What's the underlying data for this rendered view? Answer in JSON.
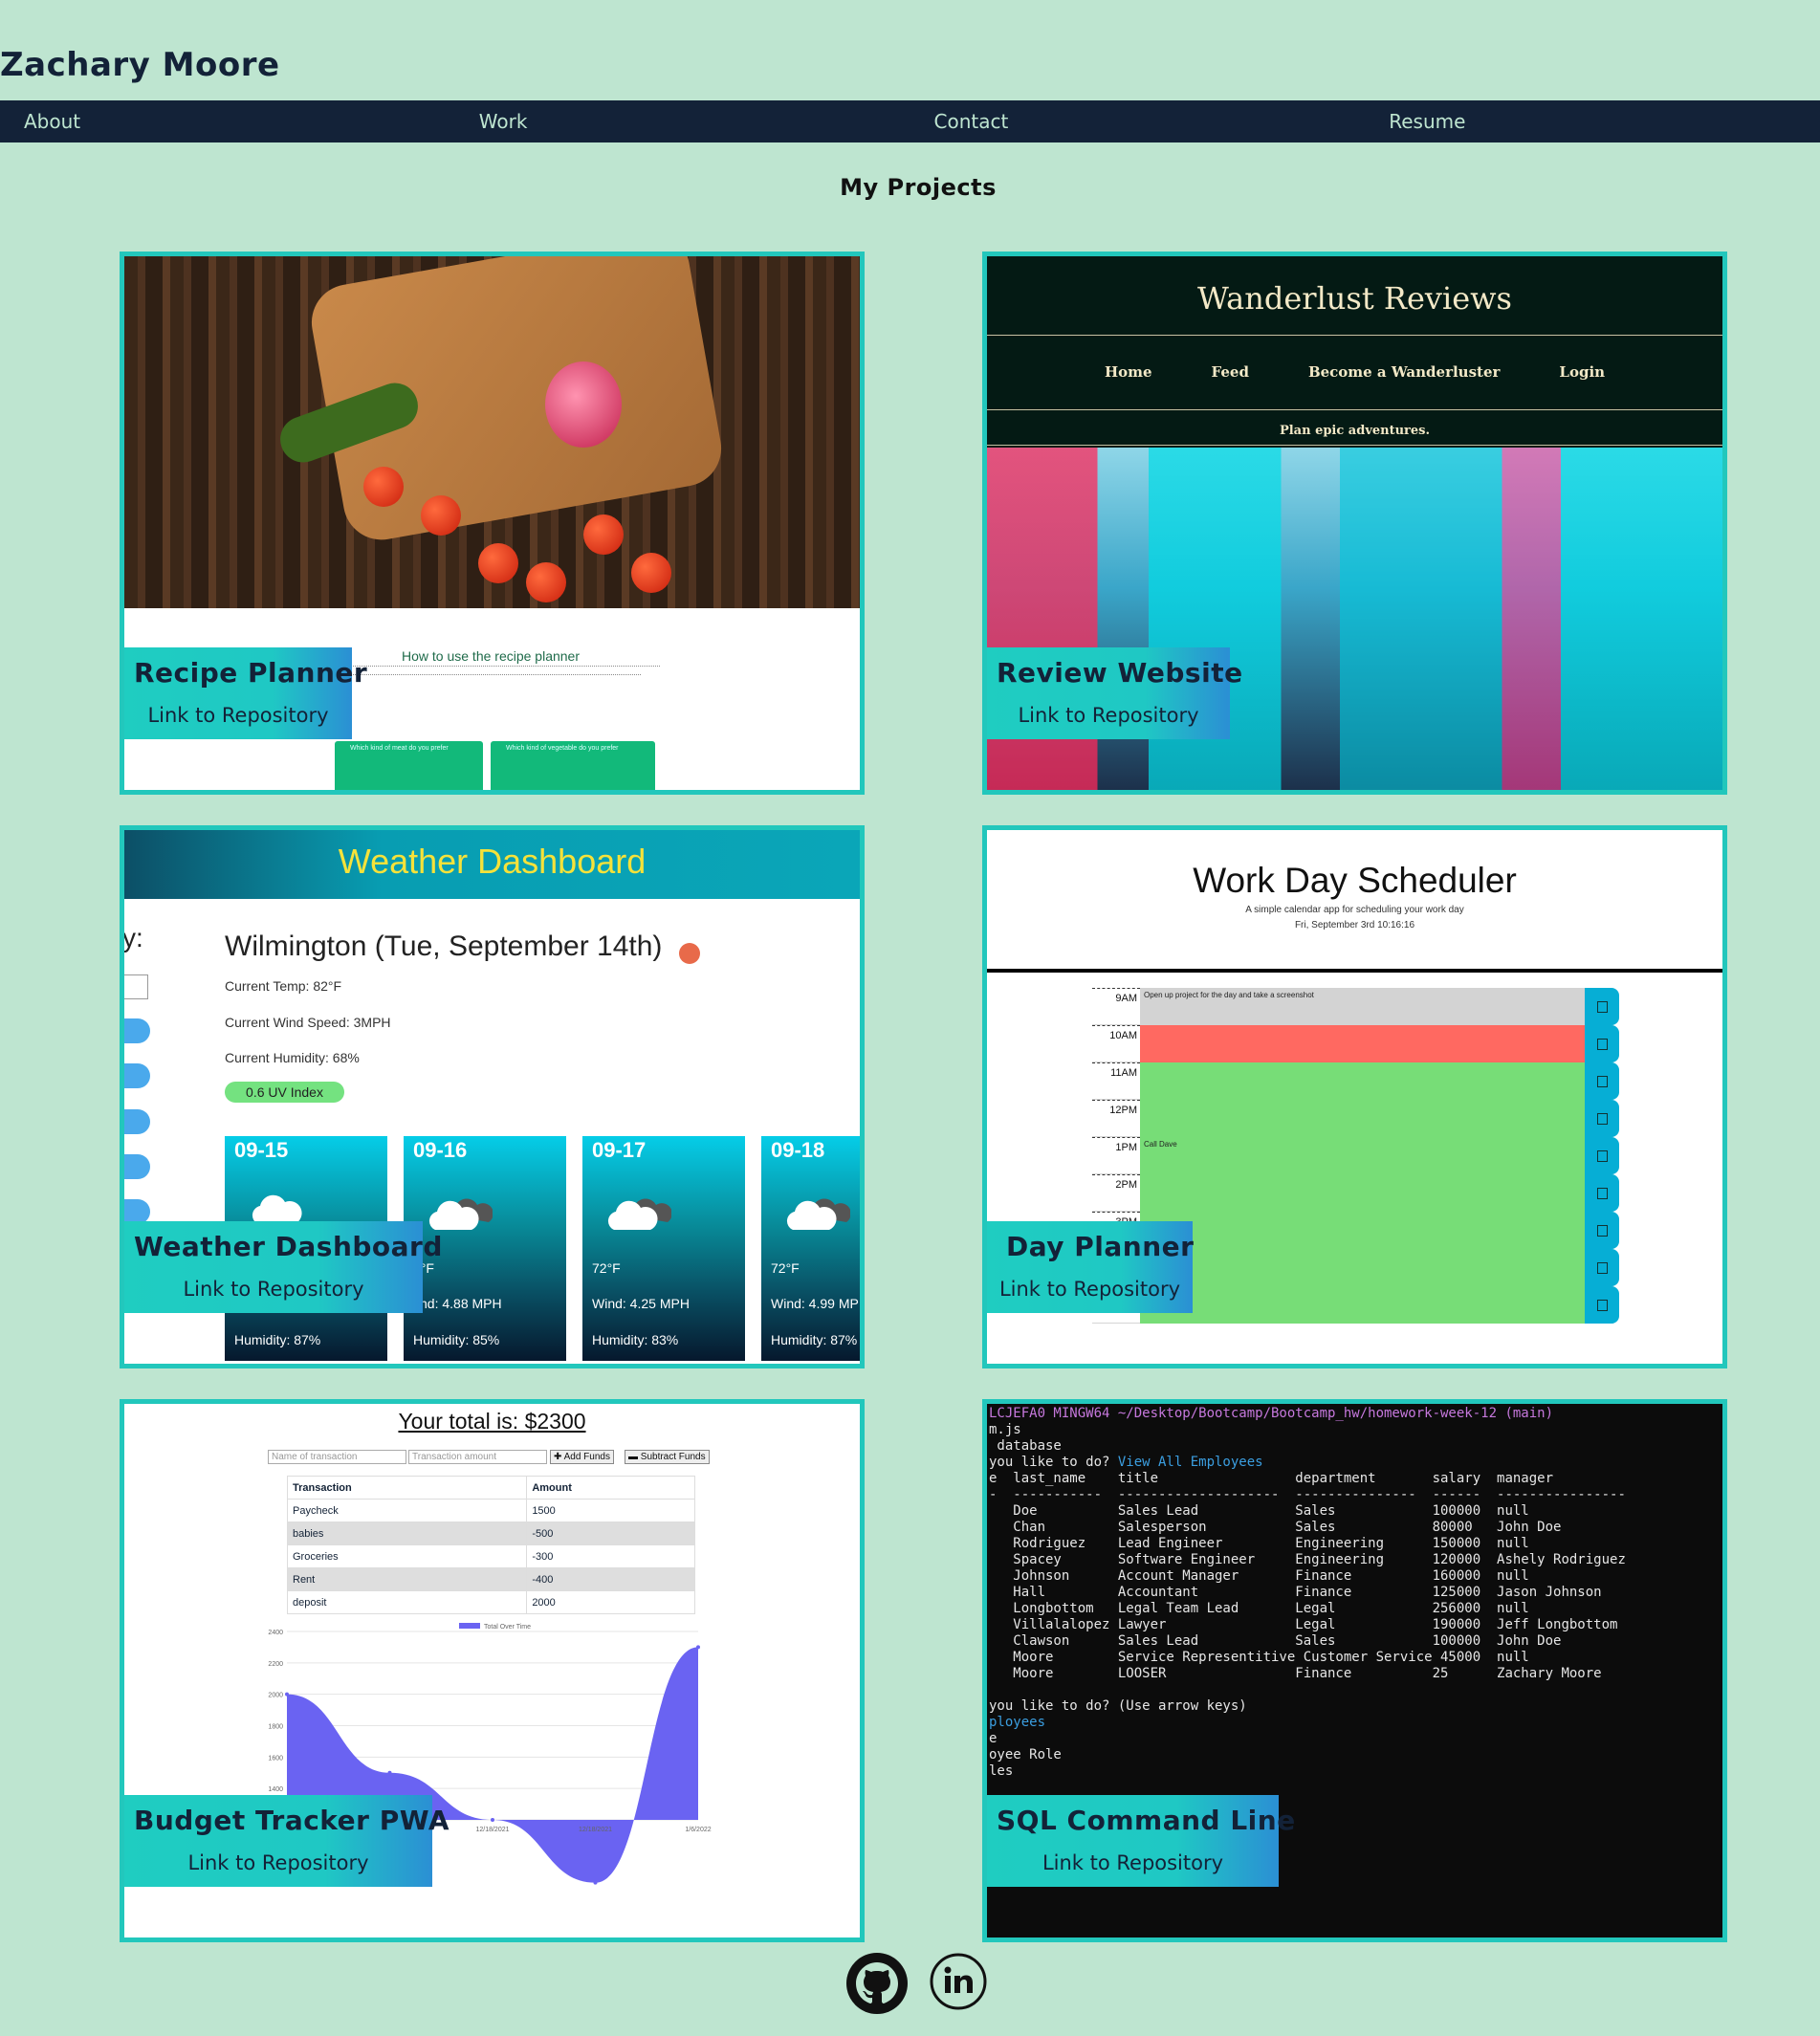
{
  "header": {
    "title": "Zachary Moore"
  },
  "nav": {
    "items": [
      "About",
      "Work",
      "Contact",
      "Resume"
    ]
  },
  "main": {
    "heading": "My Projects",
    "projects": [
      {
        "title": "Recipe Planner",
        "link": "Link to Repository"
      },
      {
        "title": "Review Website",
        "link": "Link to Repository"
      },
      {
        "title": "Weather Dashboard",
        "link": "Link to Repository"
      },
      {
        "title": "Day Planner",
        "link": "Link to Repository"
      },
      {
        "title": "Budget Tracker PWA",
        "link": "Link to Repository"
      },
      {
        "title": "SQL Command Line",
        "link": "Link to Repository"
      }
    ]
  },
  "screens": {
    "recipe": {
      "heading": "How to use the recipe planner",
      "meat_box": "Which kind of meat do you prefer",
      "veg_box": "Which kind of vegetable do you prefer"
    },
    "wanderlust": {
      "title": "Wanderlust Reviews",
      "nav": [
        "Home",
        "Feed",
        "Become a Wanderluster",
        "Login"
      ],
      "tagline": "Plan epic adventures."
    },
    "weather": {
      "header": "Weather Dashboard",
      "prefix": "y:",
      "city": "Wilmington (Tue, September 14th)",
      "temp": "Current Temp: 82°F",
      "wind": "Current Wind Speed: 3MPH",
      "humidity": "Current Humidity: 68%",
      "uv": "0.6 UV Index",
      "forecast": [
        {
          "date": "09-15",
          "temp": "",
          "wind": "",
          "humidity": "Humidity: 87%"
        },
        {
          "date": "09-16",
          "temp": "3°F",
          "wind": "/ind: 4.88 MPH",
          "humidity": "Humidity: 85%"
        },
        {
          "date": "09-17",
          "temp": "72°F",
          "wind": "Wind: 4.25 MPH",
          "humidity": "Humidity: 83%"
        },
        {
          "date": "09-18",
          "temp": "72°F",
          "wind": "Wind: 4.99 MP",
          "humidity": "Humidity: 87%"
        }
      ]
    },
    "scheduler": {
      "title": "Work Day Scheduler",
      "subtitle": "A simple calendar app for scheduling your work day",
      "date": "Fri, September 3rd 10:16:16",
      "rows": [
        {
          "hour": "9AM",
          "text": "Open up project for the day and take a screenshot",
          "state": "past"
        },
        {
          "hour": "10AM",
          "text": "",
          "state": "present"
        },
        {
          "hour": "11AM",
          "text": "",
          "state": "future"
        },
        {
          "hour": "12PM",
          "text": "",
          "state": "future"
        },
        {
          "hour": "1PM",
          "text": "Call Dave",
          "state": "future"
        },
        {
          "hour": "2PM",
          "text": "",
          "state": "future"
        },
        {
          "hour": "3PM",
          "text": "",
          "state": "future"
        },
        {
          "hour": "",
          "text": "",
          "state": "future"
        },
        {
          "hour": "",
          "text": "",
          "state": "future"
        }
      ]
    },
    "budget": {
      "total": "Your total is: $2300",
      "name_placeholder": "Name of transaction",
      "amount_placeholder": "Transaction amount",
      "add_label": "✚ Add Funds",
      "sub_label": "▬ Subtract Funds",
      "headers": [
        "Transaction",
        "Amount"
      ],
      "rows": [
        [
          "Paycheck",
          "1500"
        ],
        [
          "babies",
          "-500"
        ],
        [
          "Groceries",
          "-300"
        ],
        [
          "Rent",
          "-400"
        ],
        [
          "deposit",
          "2000"
        ]
      ],
      "legend": "Total Over Time",
      "yticks": [
        "2400",
        "2200",
        "2000",
        "1800",
        "1600",
        "1400",
        "1200"
      ],
      "xticks": [
        "12/18/2021",
        "12/18/2021",
        "1/6/2022"
      ]
    },
    "sql": {
      "prompt": "LCJEFA0 MINGW64 ~/Desktop/Bootcamp/Bootcamp_hw/homework-week-12 (main)",
      "lines": [
        "m.js",
        " database",
        "you like to do? ",
        "e  last_name    title                 department       salary  manager",
        "-  -----------  --------------------  ---------------  ------  ----------------",
        "   Doe          Sales Lead            Sales            100000  null",
        "   Chan         Salesperson           Sales            80000   John Doe",
        "   Rodriguez    Lead Engineer         Engineering      150000  null",
        "   Spacey       Software Engineer     Engineering      120000  Ashely Rodriguez",
        "   Johnson      Account Manager       Finance          160000  null",
        "   Hall         Accountant            Finance          125000  Jason Johnson",
        "   Longbottom   Legal Team Lead       Legal            256000  null",
        "   Villalalopez Lawyer                Legal            190000  Jeff Longbottom",
        "   Clawson      Sales Lead            Sales            100000  John Doe",
        "   Moore        Service Representitive Customer Service 45000  null",
        "   Moore        LOOSER                Finance          25      Zachary Moore",
        "",
        "you like to do? (Use arrow keys)",
        "ployees",
        "e",
        "oyee Role",
        "les"
      ],
      "answer": "View All Employees"
    }
  },
  "chart_data": {
    "type": "area",
    "title": "",
    "legend": [
      "Total Over Time"
    ],
    "ylim": [
      1200,
      2400
    ],
    "series": [
      {
        "name": "Total Over Time",
        "values": [
          2000,
          1500,
          1200,
          800,
          2300
        ]
      }
    ]
  },
  "footer": {
    "github_icon": "github-icon",
    "linkedin_icon": "linkedin-icon"
  }
}
